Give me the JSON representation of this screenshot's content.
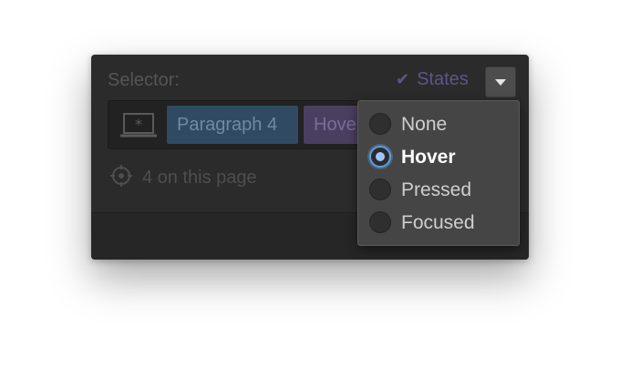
{
  "panel": {
    "selector_label": "Selector:",
    "states_label": "States",
    "chips": [
      {
        "label": "Paragraph 4"
      },
      {
        "label": "Hover"
      }
    ],
    "count_text": "4 on this page"
  },
  "states_menu": {
    "options": [
      {
        "label": "None",
        "selected": false
      },
      {
        "label": "Hover",
        "selected": true
      },
      {
        "label": "Pressed",
        "selected": false
      },
      {
        "label": "Focused",
        "selected": false
      }
    ]
  },
  "colors": {
    "panel_bg": "#2b2b2b",
    "accent_blue": "#5f9de0",
    "paragraph_chip": "#2f4a62",
    "hover_chip": "#4a3f61",
    "states_accent": "#5b568a"
  },
  "icons": [
    "checkmark-icon",
    "chevron-down-icon",
    "device-icon",
    "target-icon"
  ]
}
